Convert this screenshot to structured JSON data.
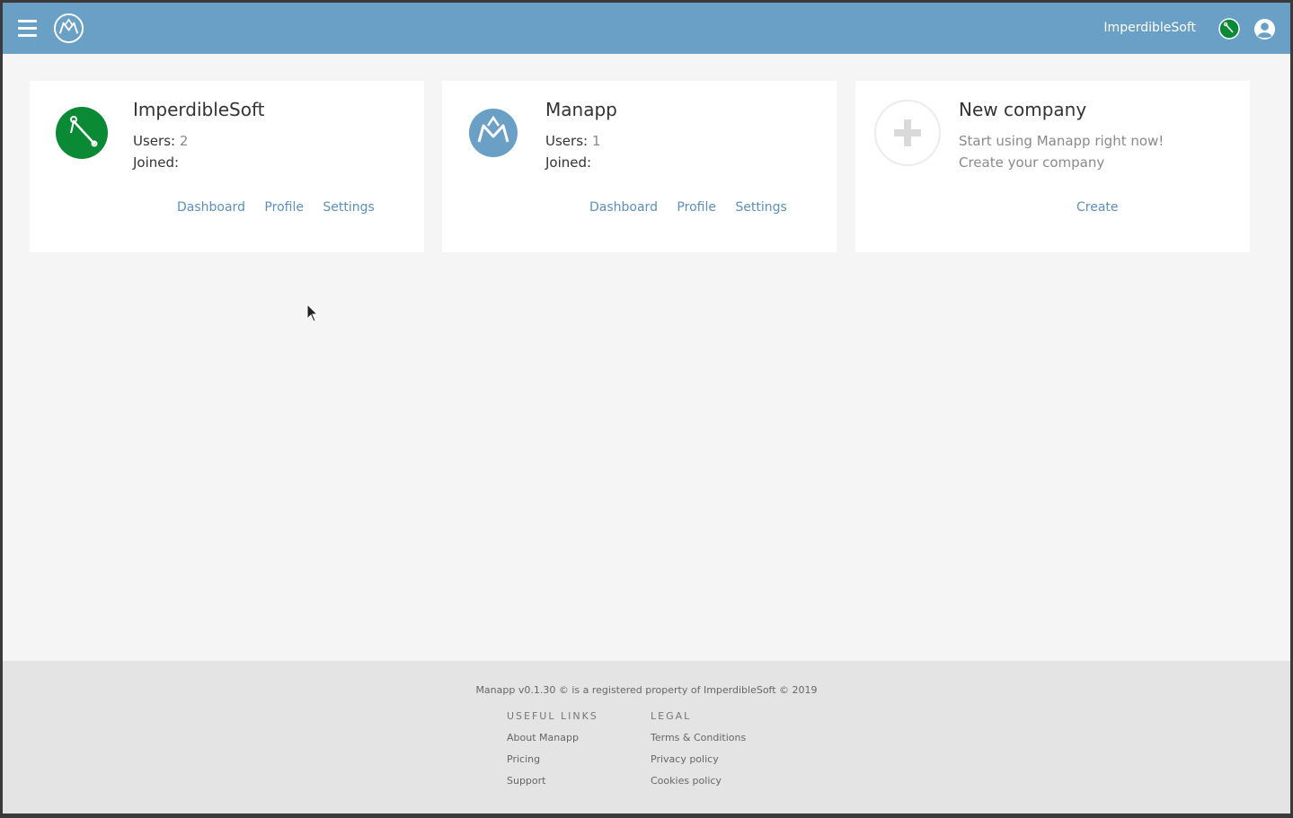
{
  "header": {
    "menu_icon": "hamburger-menu-icon",
    "app_logo": "manapp-logo",
    "company_name": "ImperdibleSoft",
    "user_icon": "user-account-icon"
  },
  "companies": [
    {
      "name": "ImperdibleSoft",
      "logo": "safety-pin-logo",
      "users_label": "Users",
      "users_value": "2",
      "joined_label": "Joined",
      "joined_value": "",
      "links": {
        "dashboard": "Dashboard",
        "profile": "Profile",
        "settings": "Settings"
      }
    },
    {
      "name": "Manapp",
      "logo": "manapp-logo",
      "users_label": "Users",
      "users_value": "1",
      "joined_label": "Joined",
      "joined_value": "",
      "links": {
        "dashboard": "Dashboard",
        "profile": "Profile",
        "settings": "Settings"
      }
    }
  ],
  "new_company": {
    "title": "New company",
    "icon": "plus-icon",
    "line1": "Start using Manapp right now!",
    "line2": "Create your company",
    "create_label": "Create"
  },
  "footer": {
    "copyright": "Manapp v0.1.30 © is a registered property of ImperdibleSoft © 2019",
    "useful_links": {
      "heading": "USEFUL LINKS",
      "items": [
        "About Manapp",
        "Pricing",
        "Support"
      ]
    },
    "legal": {
      "heading": "LEGAL",
      "items": [
        "Terms & Conditions",
        "Privacy policy",
        "Cookies policy"
      ]
    }
  },
  "colors": {
    "header_bg": "#6a9fc6",
    "link": "#5b8fbe",
    "imperdible_green": "#0a8a35",
    "manapp_blue": "#6a9fc6"
  }
}
